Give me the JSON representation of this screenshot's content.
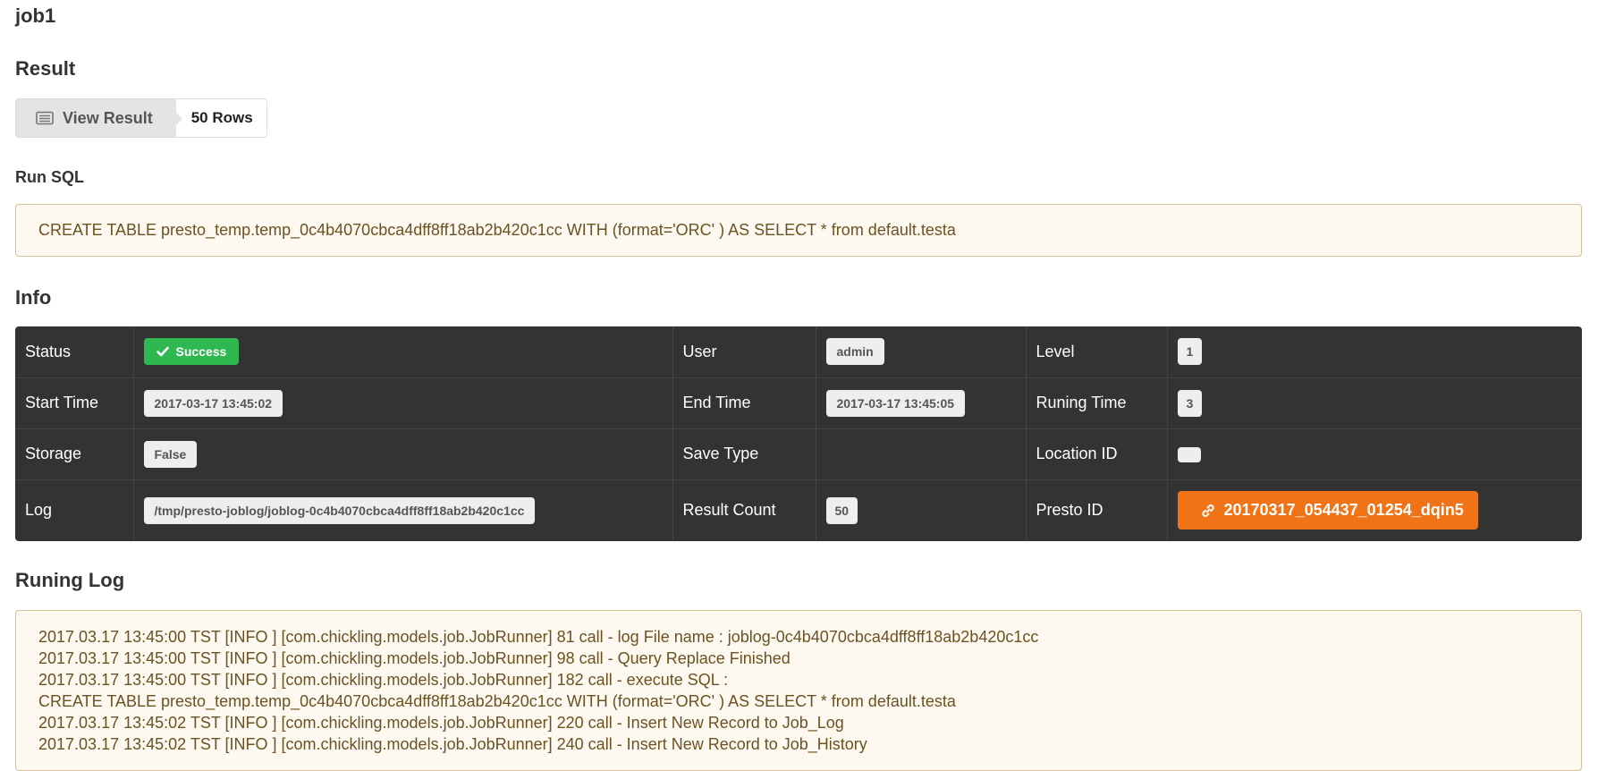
{
  "job": {
    "title": "job1"
  },
  "result": {
    "section_title": "Result",
    "view_button_label": "View Result",
    "rows_label": "50 Rows"
  },
  "run_sql": {
    "section_title": "Run SQL",
    "sql": "CREATE TABLE presto_temp.temp_0c4b4070cbca4dff8ff18ab2b420c1cc WITH (format='ORC' ) AS SELECT * from default.testa"
  },
  "info": {
    "section_title": "Info",
    "status_label": "Status",
    "status_value": "Success",
    "user_label": "User",
    "user_value": "admin",
    "level_label": "Level",
    "level_value": "1",
    "start_time_label": "Start Time",
    "start_time_value": "2017-03-17 13:45:02",
    "end_time_label": "End Time",
    "end_time_value": "2017-03-17 13:45:05",
    "running_time_label": "Runing Time",
    "running_time_value": "3",
    "storage_label": "Storage",
    "storage_value": "False",
    "save_type_label": "Save Type",
    "save_type_value": "",
    "location_id_label": "Location ID",
    "location_id_value": "",
    "log_label": "Log",
    "log_value": "/tmp/presto-joblog/joblog-0c4b4070cbca4dff8ff18ab2b420c1cc",
    "result_count_label": "Result Count",
    "result_count_value": "50",
    "presto_id_label": "Presto ID",
    "presto_id_value": "20170317_054437_01254_dqin5"
  },
  "running_log": {
    "section_title": "Runing Log",
    "lines": [
      "2017.03.17 13:45:00 TST [INFO ] [com.chickling.models.job.JobRunner] 81 call - log File name : joblog-0c4b4070cbca4dff8ff18ab2b420c1cc",
      "2017.03.17 13:45:00 TST [INFO ] [com.chickling.models.job.JobRunner] 98 call - Query Replace Finished",
      "2017.03.17 13:45:00 TST [INFO ] [com.chickling.models.job.JobRunner] 182 call - execute SQL :",
      "CREATE TABLE presto_temp.temp_0c4b4070cbca4dff8ff18ab2b420c1cc WITH (format='ORC' ) AS SELECT * from default.testa",
      "2017.03.17 13:45:02 TST [INFO ] [com.chickling.models.job.JobRunner] 220 call - Insert New Record to Job_Log",
      "2017.03.17 13:45:02 TST [INFO ] [com.chickling.models.job.JobRunner] 240 call - Insert New Record to Job_History"
    ]
  },
  "colors": {
    "success": "#2eb84f",
    "presto_button": "#f07318",
    "info_table_bg": "#333333",
    "sql_box_bg": "#fdf8f0",
    "sql_box_border": "#d8c396",
    "sql_text": "#6b5321"
  },
  "icons": {
    "view_result": "list-icon",
    "status": "check-icon",
    "presto_id": "link-icon"
  }
}
